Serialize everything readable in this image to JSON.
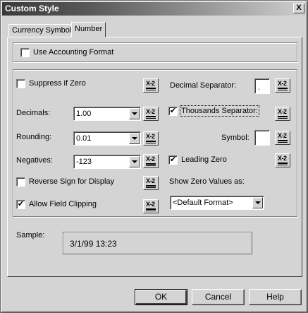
{
  "window": {
    "title": "Custom Style",
    "close": "X"
  },
  "tabs": [
    {
      "label": "Currency Symbol"
    },
    {
      "label": "Number"
    }
  ],
  "accounting": {
    "label": "Use Accounting Format",
    "checked": false
  },
  "left": {
    "suppress_zero": {
      "label": "Suppress if Zero",
      "checked": false
    },
    "decimals": {
      "label": "Decimals:",
      "value": "1.00"
    },
    "rounding": {
      "label": "Rounding:",
      "value": "0.01"
    },
    "negatives": {
      "label": "Negatives:",
      "value": "-123"
    },
    "reverse_sign": {
      "label": "Reverse Sign for Display",
      "checked": false
    },
    "allow_clipping": {
      "label": "Allow Field Clipping",
      "checked": true
    }
  },
  "right": {
    "decimal_separator": {
      "label": "Decimal Separator:",
      "value": "."
    },
    "thousands_separator": {
      "label": "Thousands Separator:",
      "checked": true
    },
    "symbol": {
      "label": "Symbol:",
      "value": ""
    },
    "leading_zero": {
      "label": "Leading Zero",
      "checked": true
    },
    "show_zero": {
      "label": "Show Zero Values as:",
      "value": "<Default Format>"
    }
  },
  "formula_button": "X-2",
  "check_mark": "✔",
  "sample": {
    "label": "Sample:",
    "value": "3/1/99  13:23"
  },
  "buttons": {
    "ok": "OK",
    "cancel": "Cancel",
    "help": "Help"
  }
}
